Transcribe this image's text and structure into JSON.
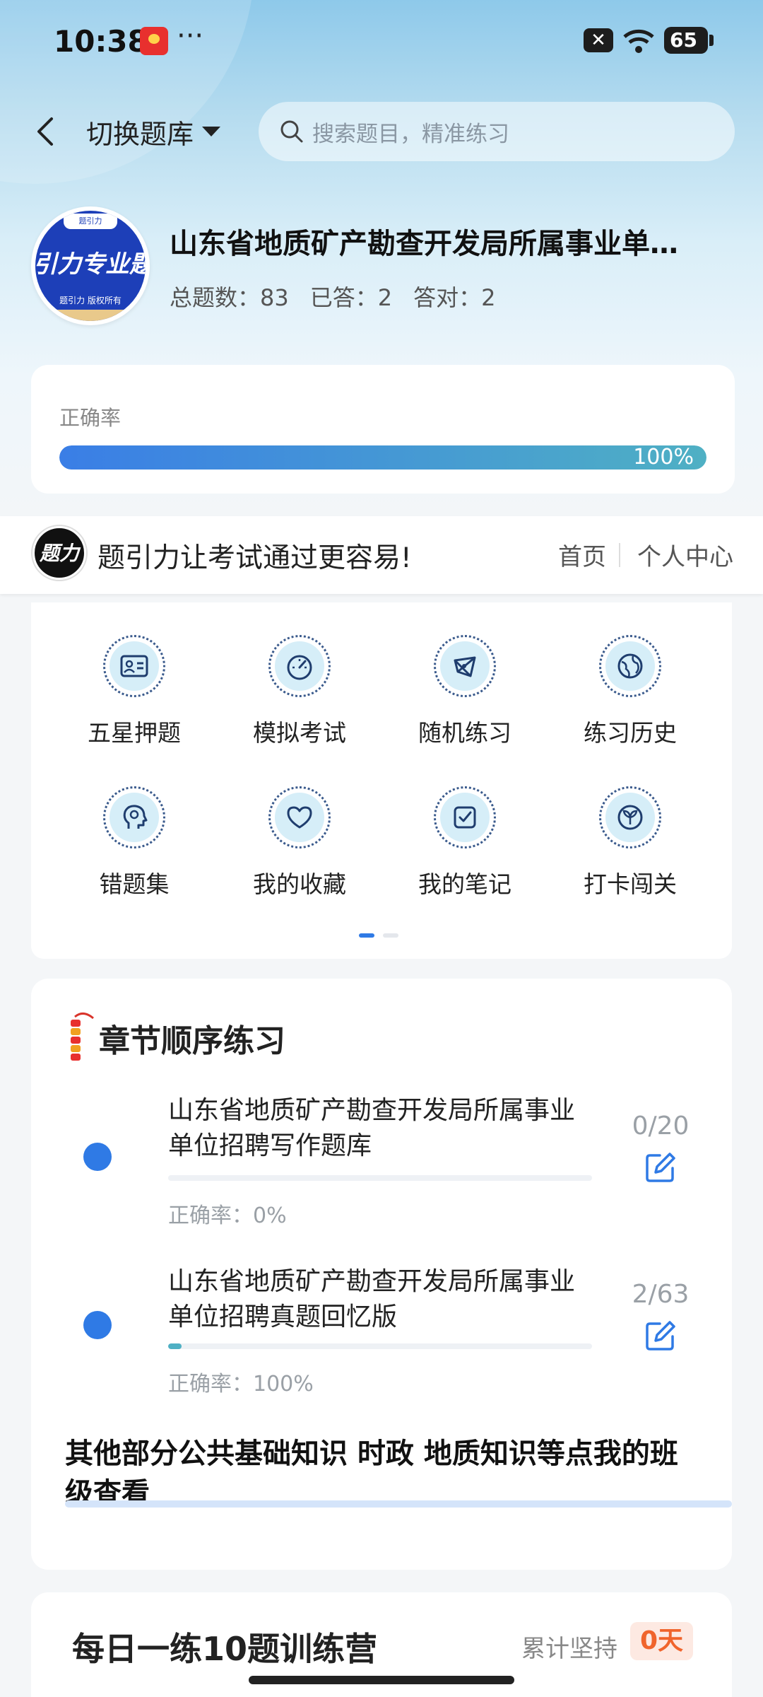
{
  "status_bar": {
    "time": "10:38",
    "dots": "···",
    "battery": "65"
  },
  "header": {
    "switch_label": "切换题库",
    "search_placeholder": "搜索题目，精准练习"
  },
  "bank": {
    "logo_tag": "题引力",
    "logo_text": "引力专业题",
    "logo_small": "题引力 版权所有",
    "title": "山东省地质矿产勘查开发局所属事业单…",
    "total": "总题数：83",
    "answered": "已答：2",
    "correct": "答对：2"
  },
  "accuracy": {
    "label": "正确率",
    "percent_text": "100%",
    "value": 1.0
  },
  "promo": {
    "logo_text": "题力",
    "slogan": "题引力让考试通过更容易!",
    "home": "首页",
    "personal": "个人中心"
  },
  "grid": {
    "items": [
      {
        "label": "五星押题",
        "icon": "id-card-icon"
      },
      {
        "label": "模拟考试",
        "icon": "speedometer-icon"
      },
      {
        "label": "随机练习",
        "icon": "network-icon"
      },
      {
        "label": "练习历史",
        "icon": "globe-icon"
      },
      {
        "label": "错题集",
        "icon": "head-profile-icon"
      },
      {
        "label": "我的收藏",
        "icon": "heart-icon"
      },
      {
        "label": "我的笔记",
        "icon": "note-check-icon"
      },
      {
        "label": "打卡闯关",
        "icon": "leaf-badge-icon"
      }
    ],
    "page_index": 1,
    "page_count": 2
  },
  "chapter": {
    "title": "章节顺序练习",
    "items": [
      {
        "name": "山东省地质矿产勘查开发局所属事业单位招聘写作题库",
        "accuracy": "正确率：0%",
        "count": "0/20",
        "progress": 0.0
      },
      {
        "name": "山东省地质矿产勘查开发局所属事业单位招聘真题回忆版",
        "accuracy": "正确率：100%",
        "count": "2/63",
        "progress": 0.032
      }
    ],
    "other_link": "其他部分公共基础知识 时政 地质知识等点我的班级查看"
  },
  "daily": {
    "title": "每日一练10题训练营",
    "keep_label": "累计坚持",
    "days": "0天"
  },
  "colors": {
    "accent": "#2f7ae5",
    "teal": "#4fb0c4",
    "orange": "#f0642c"
  }
}
